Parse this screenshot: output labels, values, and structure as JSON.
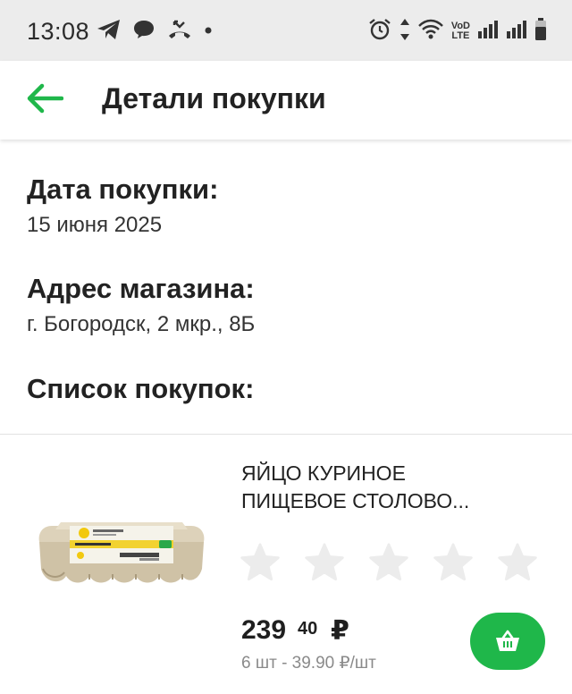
{
  "status_bar": {
    "time": "13:08",
    "icons_left": [
      "telegram-icon",
      "chat-bubble-icon",
      "missed-call-icon",
      "dot-icon"
    ],
    "icons_right": [
      "alarm-icon",
      "data-arrows-icon",
      "wifi-icon",
      "volte-icon",
      "signal-icon",
      "signal-icon",
      "battery-icon"
    ],
    "volte_top": "VoD",
    "volte_bottom": "LTE"
  },
  "app_bar": {
    "title": "Детали покупки",
    "back_icon": "arrow-left-icon",
    "accent_color": "#1fb74a"
  },
  "purchase": {
    "date_label": "Дата покупки:",
    "date_value": "15 июня 2025",
    "address_label": "Адрес магазина:",
    "address_value": "г. Богородск, 2 мкр., 8Б",
    "list_label": "Список покупок:"
  },
  "items": [
    {
      "name_line1": "ЯЙЦО КУРИНОЕ",
      "name_line2": "ПИЩЕВОЕ СТОЛОВО...",
      "image_icon": "egg-carton-image",
      "rating": 0,
      "rating_max": 5,
      "price_rub": "239",
      "price_kop": "40",
      "currency": "₽",
      "quantity_price": "6 шт - 39.90 ₽/шт",
      "cart_icon": "basket-icon"
    }
  ]
}
